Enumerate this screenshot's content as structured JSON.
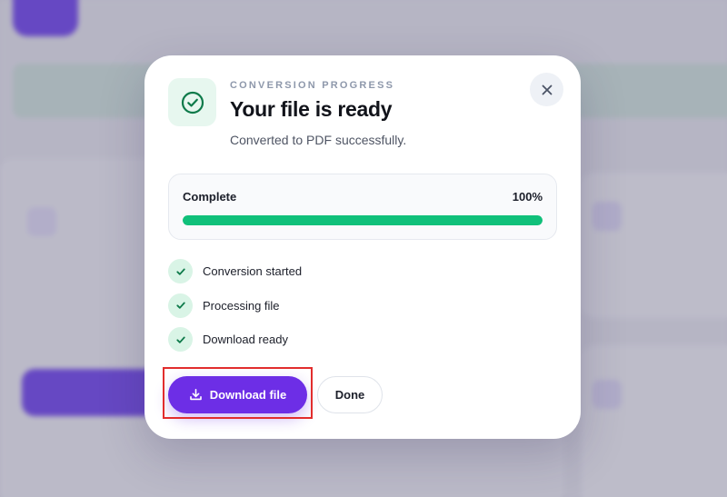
{
  "modal": {
    "eyebrow": "CONVERSION PROGRESS",
    "title": "Your file is ready",
    "subtitle": "Converted to PDF successfully.",
    "status_icon": "check-circle-icon",
    "close_icon": "close-icon"
  },
  "progress": {
    "label": "Complete",
    "value_text": "100%",
    "fraction": 1.0
  },
  "steps": [
    {
      "label": "Conversion started",
      "icon": "check-icon"
    },
    {
      "label": "Processing file",
      "icon": "check-icon"
    },
    {
      "label": "Download ready",
      "icon": "check-icon"
    }
  ],
  "actions": {
    "download_label": "Download file",
    "download_icon": "download-icon",
    "done_label": "Done"
  },
  "colors": {
    "accent": "#6d2ee6",
    "success": "#10c07a",
    "success_bg": "#d9f4e6",
    "highlight": "#e22d2d"
  }
}
